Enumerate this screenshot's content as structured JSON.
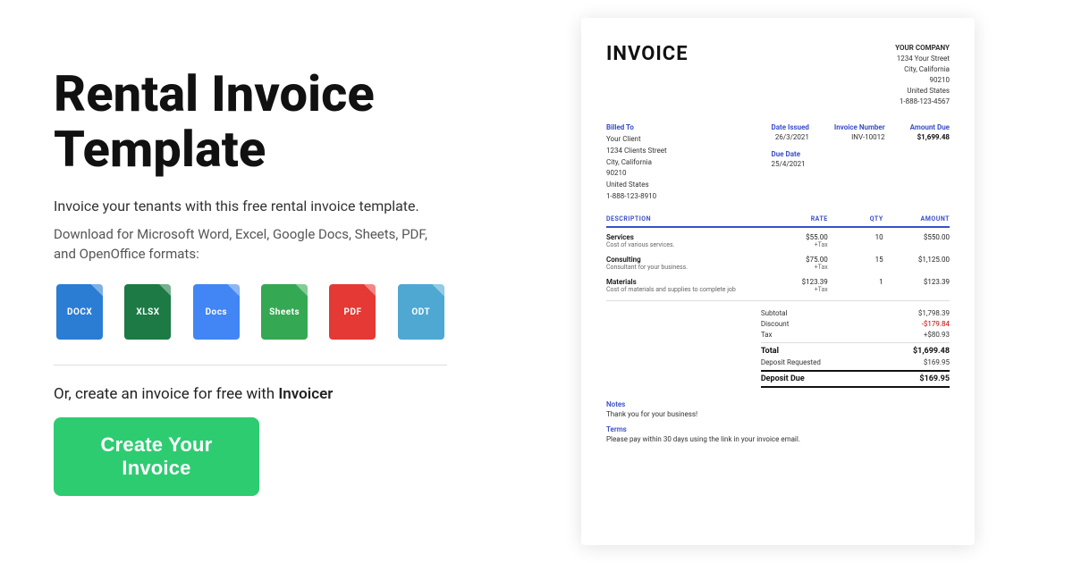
{
  "left": {
    "title_line1": "Rental Invoice",
    "title_line2": "Template",
    "subtitle": "Invoice your tenants with this free rental invoice template.",
    "download_text": "Download for Microsoft Word, Excel, Google Docs, Sheets, PDF, and OpenOffice formats:",
    "formats": [
      {
        "id": "docx",
        "label": "DOCX",
        "color": "#2B7CD3"
      },
      {
        "id": "xlsx",
        "label": "XLSX",
        "color": "#1D7A45"
      },
      {
        "id": "gdocs",
        "label": "Docs",
        "color": "#4285F4"
      },
      {
        "id": "gsheets",
        "label": "Sheets",
        "color": "#34A853"
      },
      {
        "id": "pdf",
        "label": "PDF",
        "color": "#E53935"
      },
      {
        "id": "odt",
        "label": "ODT",
        "color": "#4EA8D2"
      }
    ],
    "or_text_prefix": "Or, create an invoice for free with ",
    "or_text_brand": "Invoicer",
    "cta_label": "Create Your Invoice",
    "cta_color": "#2ECC71"
  },
  "invoice": {
    "title": "INVOICE",
    "company": {
      "name": "YOUR COMPANY",
      "address_line1": "1234 Your Street",
      "address_line2": "City, California",
      "zip": "90210",
      "country": "United States",
      "phone": "1-888-123-4567"
    },
    "billed_to_label": "Billed To",
    "billed_to": {
      "name": "Your Client",
      "address": "1234 Clients Street",
      "city": "City, California",
      "zip": "90210",
      "country": "United States",
      "phone": "1-888-123-8910"
    },
    "date_issued_label": "Date Issued",
    "date_issued": "26/3/2021",
    "due_date_label": "Due Date",
    "due_date": "25/4/2021",
    "invoice_number_label": "Invoice Number",
    "invoice_number": "INV-10012",
    "amount_due_label": "Amount Due",
    "amount_due": "$1,699.48",
    "table": {
      "headers": [
        "DESCRIPTION",
        "RATE",
        "QTY",
        "AMOUNT"
      ],
      "rows": [
        {
          "name": "Services",
          "desc": "Cost of various services.",
          "rate": "$55.00",
          "tax_label": "+Tax",
          "qty": "10",
          "amount": "$550.00"
        },
        {
          "name": "Consulting",
          "desc": "Consultant for your business.",
          "rate": "$75.00",
          "tax_label": "+Tax",
          "qty": "15",
          "amount": "$1,125.00"
        },
        {
          "name": "Materials",
          "desc": "Cost of materials and supplies to complete job",
          "rate": "$123.39",
          "tax_label": "+Tax",
          "qty": "1",
          "amount": "$123.39"
        }
      ]
    },
    "summary": {
      "subtotal_label": "Subtotal",
      "subtotal_val": "$1,798.39",
      "discount_label": "Discount",
      "discount_val": "-$179.84",
      "tax_label": "Tax",
      "tax_val": "+$80.93",
      "total_label": "Total",
      "total_val": "$1,699.48",
      "deposit_requested_label": "Deposit Requested",
      "deposit_requested_val": "$169.95",
      "deposit_due_label": "Deposit Due",
      "deposit_due_val": "$169.95"
    },
    "notes_label": "Notes",
    "notes_text": "Thank you for your business!",
    "terms_label": "Terms",
    "terms_text": "Please pay within 30 days using the link in your invoice email."
  }
}
